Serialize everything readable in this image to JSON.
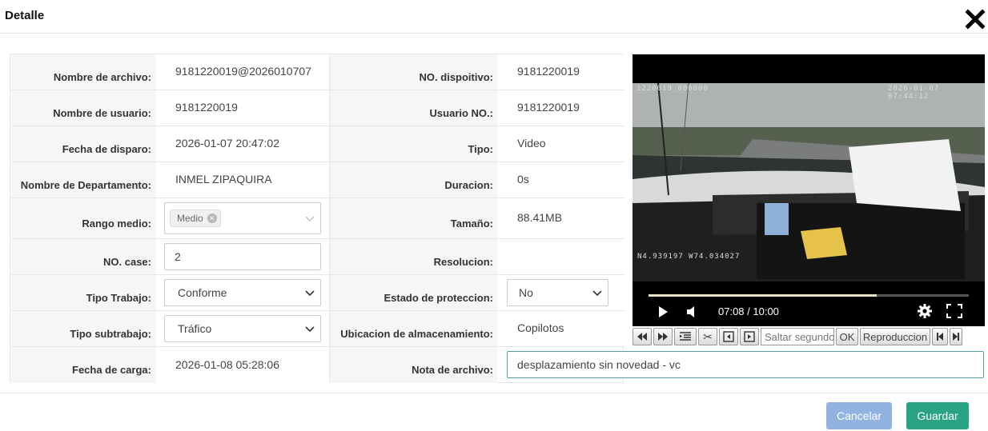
{
  "dialog": {
    "title": "Detalle"
  },
  "fields": {
    "nombre_archivo": {
      "label": "Nombre de archivo:",
      "value": "9181220019@2026010707"
    },
    "no_dispositivo": {
      "label": "NO. dispoitivo:",
      "value": "9181220019"
    },
    "nombre_usuario": {
      "label": "Nombre de usuario:",
      "value": "9181220019"
    },
    "usuario_no": {
      "label": "Usuario NO.:",
      "value": "9181220019"
    },
    "fecha_disparo": {
      "label": "Fecha de disparo:",
      "value": "2026-01-07 20:47:02"
    },
    "tipo": {
      "label": "Tipo:",
      "value": "Video"
    },
    "departamento": {
      "label": "Nombre de Departamento:",
      "value": "INMEL ZIPAQUIRA"
    },
    "duracion": {
      "label": "Duracion:",
      "value": "0s"
    },
    "rango_medio": {
      "label": "Rango medio:",
      "tag": "Medio"
    },
    "tamano": {
      "label": "Tamaño:",
      "value": "88.41MB"
    },
    "no_case": {
      "label": "NO. case:",
      "value": "2"
    },
    "resolucion": {
      "label": "Resolucion:",
      "value": ""
    },
    "tipo_trabajo": {
      "label": "Tipo Trabajo:",
      "value": "Conforme"
    },
    "estado_proteccion": {
      "label": "Estado de proteccion:",
      "value": "No"
    },
    "tipo_subtrabajo": {
      "label": "Tipo subtrabajo:",
      "value": "Tráfico"
    },
    "ubicacion": {
      "label": "Ubicacion de almacenamiento:",
      "value": "Copilotos"
    },
    "fecha_carga": {
      "label": "Fecha de carga:",
      "value": "2026-01-08 05:28:06"
    },
    "nota_archivo": {
      "label": "Nota de archivo:",
      "value": "desplazamiento sin novedad - vc"
    }
  },
  "video": {
    "osd_id": "1220019_000000",
    "osd_datetime": "2026-01-07 07:44:12",
    "osd_gps": "N4.939197 W74.034027",
    "time_display": "07:08 / 10:00",
    "progress": 0.7133
  },
  "toolbar": {
    "seek_placeholder": "Saltar segundos",
    "ok_label": "OK",
    "playback_label": "Reproduccion"
  },
  "footer": {
    "cancel_label": "Cancelar",
    "save_label": "Guardar"
  },
  "colors": {
    "cancel": "#91b3e0",
    "save": "#2aa385",
    "label_bg": "#f5f6f7",
    "border": "#e6e6e6"
  }
}
